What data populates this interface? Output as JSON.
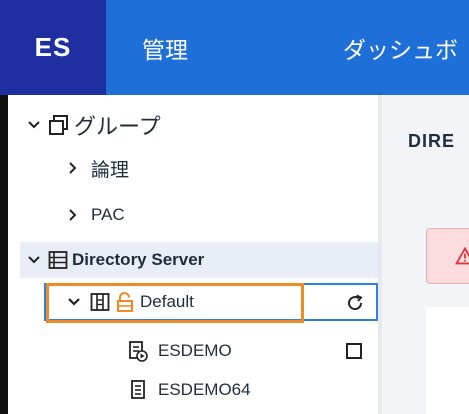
{
  "header": {
    "logo": "ES",
    "nav_admin": "管理",
    "nav_dashboard": "ダッシュボ"
  },
  "sidebar": {
    "group_label": "グループ",
    "logic_label": "論理",
    "pac_label": "PAC",
    "directory_server_label": "Directory Server",
    "default_label": "Default",
    "esdemo_label": "ESDEMO",
    "esdemo64_label": "ESDEMO64"
  },
  "main": {
    "title": "DIRE"
  },
  "colors": {
    "topbar": "#1f6fd9",
    "logo_bg": "#1f2ea0",
    "highlight": "#f08a24",
    "selected_border": "#2f7fe0",
    "lock": "#f08a24",
    "alert_bg": "#fbdde0",
    "alert_icon": "#e0303b"
  }
}
